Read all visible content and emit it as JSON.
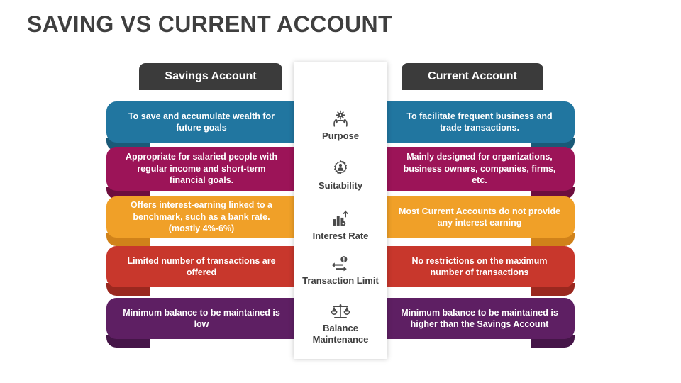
{
  "title": "SAVING VS CURRENT ACCOUNT",
  "columns": {
    "left_header": "Savings Account",
    "right_header": "Current Account"
  },
  "colors": {
    "header_bar": "#3b3b3b",
    "title_text": "#3f3f3f",
    "row1": "#2176a0",
    "row1_shadow": "#1a5977",
    "row2": "#9c1458",
    "row2_shadow": "#6d0e3e",
    "row3": "#f0a028",
    "row3_shadow": "#d0821a",
    "row4": "#c8372c",
    "row4_shadow": "#9a281f",
    "row5": "#5e1f63",
    "row5_shadow": "#451548"
  },
  "rows": [
    {
      "category": "Purpose",
      "icon": "hands-holding-target-icon",
      "left_text": "To save and accumulate wealth for future goals",
      "right_text": "To facilitate frequent business and trade transactions."
    },
    {
      "category": "Suitability",
      "icon": "gear-person-icon",
      "left_text": "Appropriate for salaried people with regular income and short-term financial goals.",
      "right_text": "Mainly designed for organizations, business owners, companies, firms, etc."
    },
    {
      "category": "Interest Rate",
      "icon": "bar-chart-percent-icon",
      "left_text": "Offers interest-earning linked to a benchmark, such as a bank rate.(mostly 4%-6%)",
      "right_text": "Most Current Accounts do not provide any interest earning"
    },
    {
      "category": "Transaction Limit",
      "icon": "exchange-arrows-coin-icon",
      "left_text": "Limited number of transactions are offered",
      "right_text": "No restrictions on the maximum number of transactions"
    },
    {
      "category": "Balance Maintenance",
      "icon": "balance-scales-icon",
      "left_text": "Minimum balance to be maintained is low",
      "right_text": "Minimum balance to be maintained is higher than the Savings Account"
    }
  ]
}
